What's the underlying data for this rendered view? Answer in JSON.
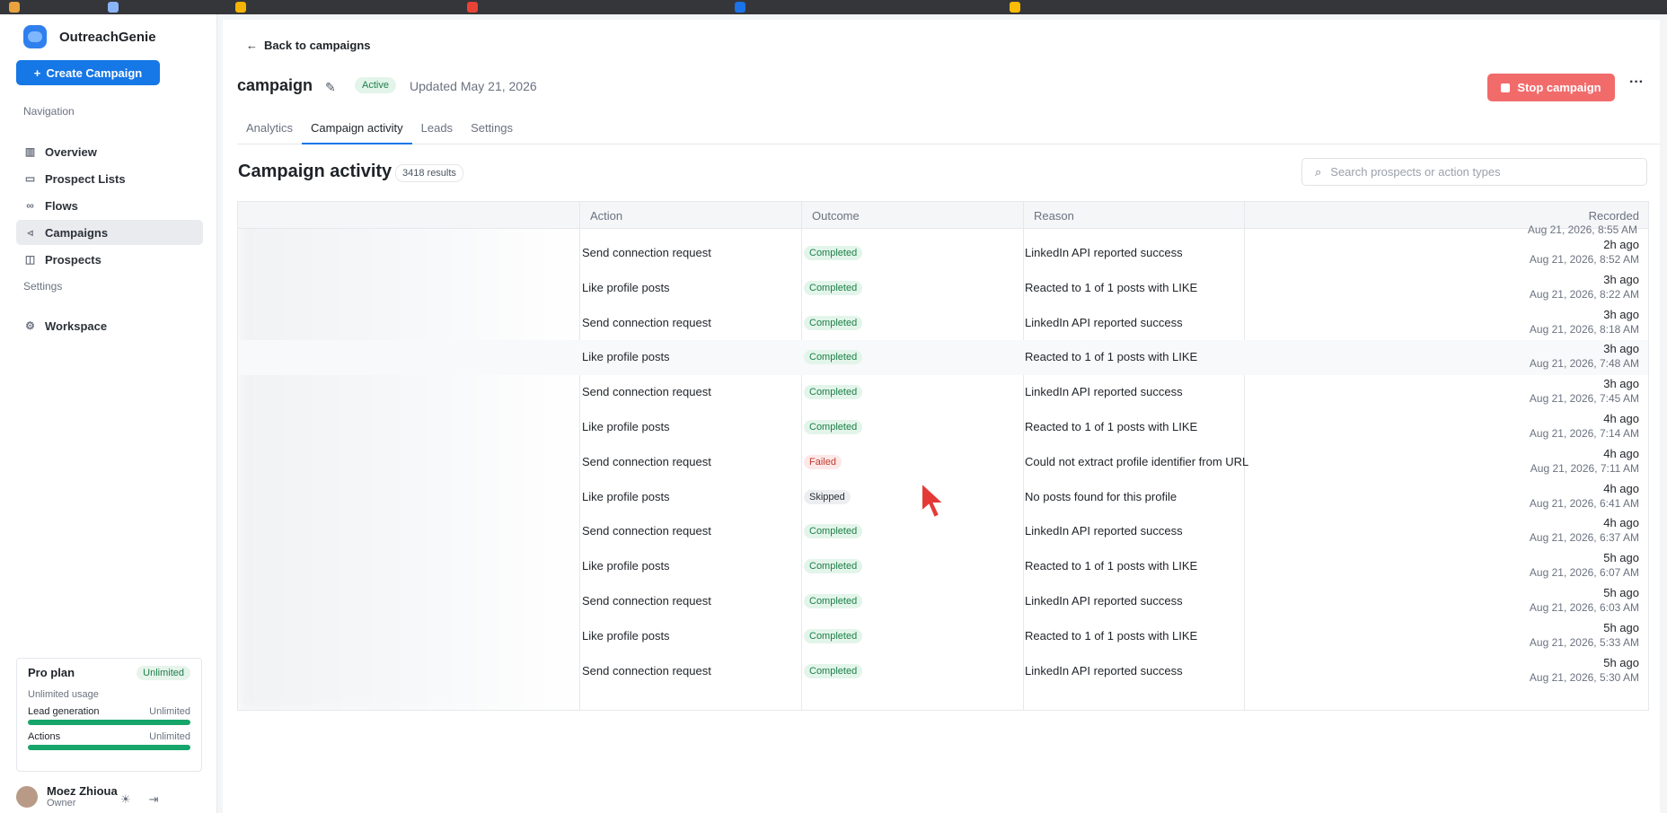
{
  "app": {
    "name": "OutreachGenie"
  },
  "sidebar": {
    "create_label": "Create Campaign",
    "nav_heading": "Navigation",
    "items": [
      {
        "label": "Overview",
        "icon": "bar-chart-icon"
      },
      {
        "label": "Prospect Lists",
        "icon": "list-folder-icon"
      },
      {
        "label": "Flows",
        "icon": "flow-icon"
      },
      {
        "label": "Campaigns",
        "icon": "megaphone-icon",
        "active": true
      },
      {
        "label": "Prospects",
        "icon": "contact-icon"
      }
    ],
    "settings_heading": "Settings",
    "settings_items": [
      {
        "label": "Workspace",
        "icon": "gear-icon"
      }
    ],
    "plan": {
      "title": "Pro plan",
      "badge": "Unlimited",
      "subtitle": "Unlimited usage",
      "lead_generation_label": "Lead generation",
      "lead_generation_value": "Unlimited",
      "actions_label": "Actions",
      "actions_value": "Unlimited"
    },
    "user": {
      "name": "Moez Zhioua",
      "role": "Owner"
    }
  },
  "header": {
    "back_label": "Back to campaigns",
    "title": "campaign",
    "status": "Active",
    "updated": "Updated May 21, 2026",
    "stop_label": "Stop campaign",
    "more_label": "···"
  },
  "tabs": [
    {
      "label": "Analytics"
    },
    {
      "label": "Campaign activity",
      "active": true
    },
    {
      "label": "Leads"
    },
    {
      "label": "Settings"
    }
  ],
  "activity": {
    "title": "Campaign activity",
    "results": "3418 results",
    "search_placeholder": "Search prospects or action types",
    "columns": [
      "Action",
      "Outcome",
      "Reason",
      "Recorded"
    ],
    "top_partial_date": "Aug 21, 2026, 8:55 AM",
    "rows": [
      {
        "action": "Send connection request",
        "outcome": "Completed",
        "reason": "LinkedIn API reported success",
        "rel": "2h ago",
        "abs": "Aug 21, 2026, 8:52 AM"
      },
      {
        "action": "Like profile posts",
        "outcome": "Completed",
        "reason": "Reacted to 1 of 1 posts with LIKE",
        "rel": "3h ago",
        "abs": "Aug 21, 2026, 8:22 AM"
      },
      {
        "action": "Send connection request",
        "outcome": "Completed",
        "reason": "LinkedIn API reported success",
        "rel": "3h ago",
        "abs": "Aug 21, 2026, 8:18 AM"
      },
      {
        "action": "Like profile posts",
        "outcome": "Completed",
        "reason": "Reacted to 1 of 1 posts with LIKE",
        "rel": "3h ago",
        "abs": "Aug 21, 2026, 7:48 AM"
      },
      {
        "action": "Send connection request",
        "outcome": "Completed",
        "reason": "LinkedIn API reported success",
        "rel": "3h ago",
        "abs": "Aug 21, 2026, 7:45 AM"
      },
      {
        "action": "Like profile posts",
        "outcome": "Completed",
        "reason": "Reacted to 1 of 1 posts with LIKE",
        "rel": "4h ago",
        "abs": "Aug 21, 2026, 7:14 AM"
      },
      {
        "action": "Send connection request",
        "outcome": "Failed",
        "reason": "Could not extract profile identifier from URL",
        "rel": "4h ago",
        "abs": "Aug 21, 2026, 7:11 AM"
      },
      {
        "action": "Like profile posts",
        "outcome": "Skipped",
        "reason": "No posts found for this profile",
        "rel": "4h ago",
        "abs": "Aug 21, 2026, 6:41 AM"
      },
      {
        "action": "Send connection request",
        "outcome": "Completed",
        "reason": "LinkedIn API reported success",
        "rel": "4h ago",
        "abs": "Aug 21, 2026, 6:37 AM"
      },
      {
        "action": "Like profile posts",
        "outcome": "Completed",
        "reason": "Reacted to 1 of 1 posts with LIKE",
        "rel": "5h ago",
        "abs": "Aug 21, 2026, 6:07 AM"
      },
      {
        "action": "Send connection request",
        "outcome": "Completed",
        "reason": "LinkedIn API reported success",
        "rel": "5h ago",
        "abs": "Aug 21, 2026, 6:03 AM"
      },
      {
        "action": "Like profile posts",
        "outcome": "Completed",
        "reason": "Reacted to 1 of 1 posts with LIKE",
        "rel": "5h ago",
        "abs": "Aug 21, 2026, 5:33 AM"
      },
      {
        "action": "Send connection request",
        "outcome": "Completed",
        "reason": "LinkedIn API reported success",
        "rel": "5h ago",
        "abs": "Aug 21, 2026, 5:30 AM"
      }
    ]
  },
  "colors": {
    "accent": "#1677e6",
    "danger": "#f26b6b",
    "success": "#16a56b"
  }
}
